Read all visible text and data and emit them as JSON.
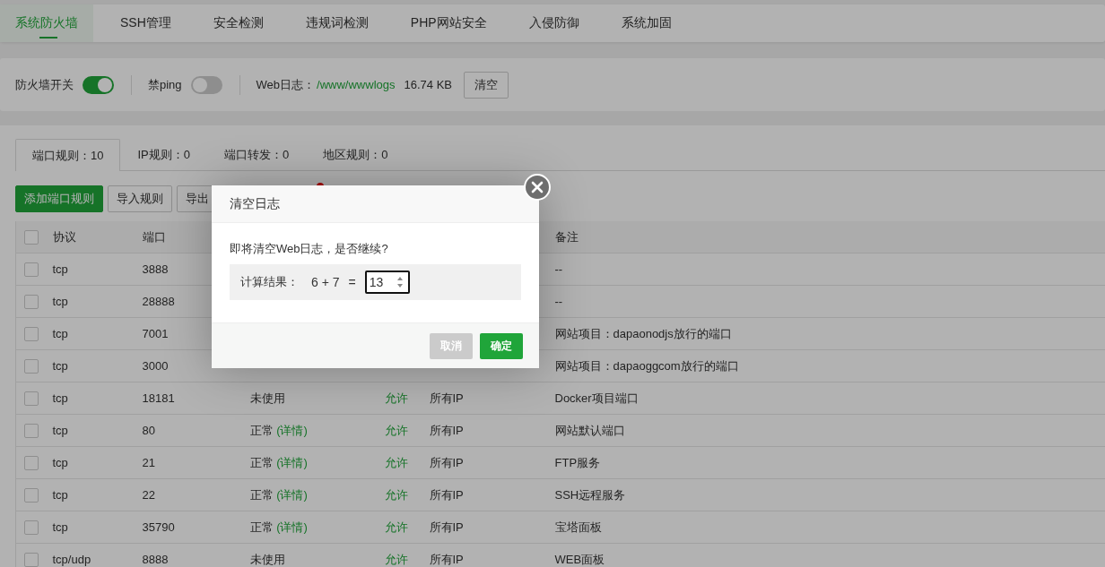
{
  "nav_tabs": [
    {
      "label": "系统防火墙",
      "selected": true
    },
    {
      "label": "SSH管理",
      "selected": false
    },
    {
      "label": "安全检测",
      "selected": false
    },
    {
      "label": "违规词检测",
      "selected": false
    },
    {
      "label": "PHP网站安全",
      "selected": false
    },
    {
      "label": "入侵防御",
      "selected": false
    },
    {
      "label": "系统加固",
      "selected": false
    }
  ],
  "switches": [
    {
      "label": "防火墙开关",
      "on": true
    },
    {
      "label": "禁ping",
      "on": false
    }
  ],
  "web_log": {
    "label": "Web日志：",
    "path": "/www/wwwlogs",
    "size": "16.74 KB",
    "button": "清空"
  },
  "rule_tabs": [
    {
      "label": "端口规则：10",
      "selected": true
    },
    {
      "label": "IP规则：0",
      "selected": false
    },
    {
      "label": "端口转发：0",
      "selected": false
    },
    {
      "label": "地区规则：0",
      "selected": false
    }
  ],
  "actions": [
    {
      "label": "添加端口规则",
      "kind": "primary"
    },
    {
      "label": "导入规则",
      "kind": "default"
    },
    {
      "label": "导出",
      "kind": "default"
    }
  ],
  "table": {
    "header_checked": false,
    "columns": [
      "协议",
      "端口",
      "备注"
    ],
    "rows": [
      {
        "checked": false,
        "protocol": "tcp",
        "port": "3888",
        "note": "--"
      },
      {
        "checked": false,
        "protocol": "tcp",
        "port": "28888",
        "note": "--"
      },
      {
        "checked": false,
        "protocol": "tcp",
        "port": "7001",
        "note": "网站项目：dapaonodjs放行的端口"
      },
      {
        "checked": false,
        "protocol": "tcp",
        "port": "3000",
        "note": "网站项目：dapaoggcom放行的端口"
      },
      {
        "checked": false,
        "protocol": "tcp",
        "port": "18181",
        "status": "未使用",
        "policy": "允许",
        "source": "所有IP",
        "note": "Docker项目端口"
      },
      {
        "checked": false,
        "protocol": "tcp",
        "port": "80",
        "status": "正常",
        "detail": "(详情)",
        "policy": "允许",
        "source": "所有IP",
        "note": "网站默认端口"
      },
      {
        "checked": false,
        "protocol": "tcp",
        "port": "21",
        "status": "正常",
        "detail": "(详情)",
        "policy": "允许",
        "source": "所有IP",
        "note": "FTP服务"
      },
      {
        "checked": false,
        "protocol": "tcp",
        "port": "22",
        "status": "正常",
        "detail": "(详情)",
        "policy": "允许",
        "source": "所有IP",
        "note": "SSH远程服务"
      },
      {
        "checked": false,
        "protocol": "tcp",
        "port": "35790",
        "status": "正常",
        "detail": "(详情)",
        "policy": "允许",
        "source": "所有IP",
        "note": "宝塔面板"
      },
      {
        "checked": false,
        "protocol": "tcp/udp",
        "port": "8888",
        "status": "未使用",
        "policy": "允许",
        "source": "所有IP",
        "note": "WEB面板"
      }
    ]
  },
  "dialog": {
    "title": "清空日志",
    "message": "即将清空Web日志，是否继续?",
    "captcha_label": "计算结果：",
    "expression": "6 + 7",
    "equals": "=",
    "answer": "13",
    "buttons": [
      {
        "label": "取消",
        "kind": "disabled"
      },
      {
        "label": "确定",
        "kind": "primary"
      }
    ]
  }
}
